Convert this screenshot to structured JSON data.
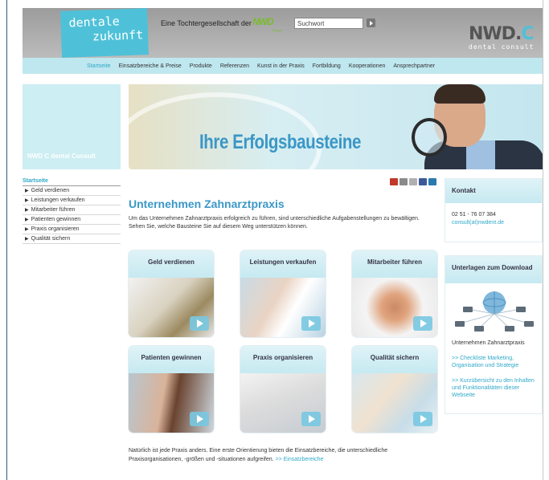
{
  "header": {
    "logo_line1": "dentale",
    "logo_line2": "zukunft",
    "tagline": "Eine Tochtergesellschaft der",
    "parent_logo": "NWD",
    "parent_logo_sub": "Gruppe",
    "search_value": "Suchwort",
    "brand_logo_main": "NWD.",
    "brand_logo_accent": "C",
    "brand_logo_sub": "dental consult"
  },
  "nav": {
    "items": [
      "Startseite",
      "Einsatzbereiche & Preise",
      "Produkte",
      "Referenzen",
      "Kunst in der Praxis",
      "Fortbildung",
      "Kooperationen",
      "Ansprechpartner"
    ]
  },
  "side_box": {
    "label": "NWD C dental Consult"
  },
  "banner": {
    "title": "Ihre Erfolgsbausteine"
  },
  "subnav": {
    "title": "Startseite",
    "items": [
      "Geld verdienen",
      "Leistungen verkaufen",
      "Mitarbeiter führen",
      "Patienten gewinnen",
      "Praxis organisieren",
      "Qualität sichern"
    ]
  },
  "main": {
    "title": "Unternehmen Zahnarztpraxis",
    "intro": "Um das Unternehmen Zahnarztpraxis erfolgreich zu führen, sind unterschiedliche Aufgabenstellungen zu bewältigen. Sehen Sie, welche Bausteine Sie auf diesem Weg unterstützen können.",
    "tiles": [
      "Geld verdienen",
      "Leistungen verkaufen",
      "Mitarbeiter führen",
      "Patienten gewinnen",
      "Praxis organisieren",
      "Qualität sichern"
    ],
    "closing_text": "Natürlich ist jede Praxis anders. Eine erste Orientierung bieten die Einsatzbereiche, die unterschiedliche Praxisorganisationen, -größen und -situationen aufgreifen.",
    "closing_link": ">> Einsatzbereiche"
  },
  "contact": {
    "title": "Kontakt",
    "phone": "02 51 - 76 07 384",
    "email": "consult(at)nwdent.de"
  },
  "downloads": {
    "title": "Unterlagen zum Download",
    "label": "Unternehmen Zahnarztpraxis",
    "links": [
      ">> Checkliste Marketing, Organisation und Strategie",
      ">> Kurzübersicht zu den Inhalten und Funktionalitäten dieser Webseite"
    ]
  },
  "colors": {
    "accent": "#3a97c7",
    "link": "#2fa8c8",
    "logo_bg": "#4ec1d8",
    "nav_bg": "#bfe7ef",
    "header_bg": "#a8a8a8"
  }
}
